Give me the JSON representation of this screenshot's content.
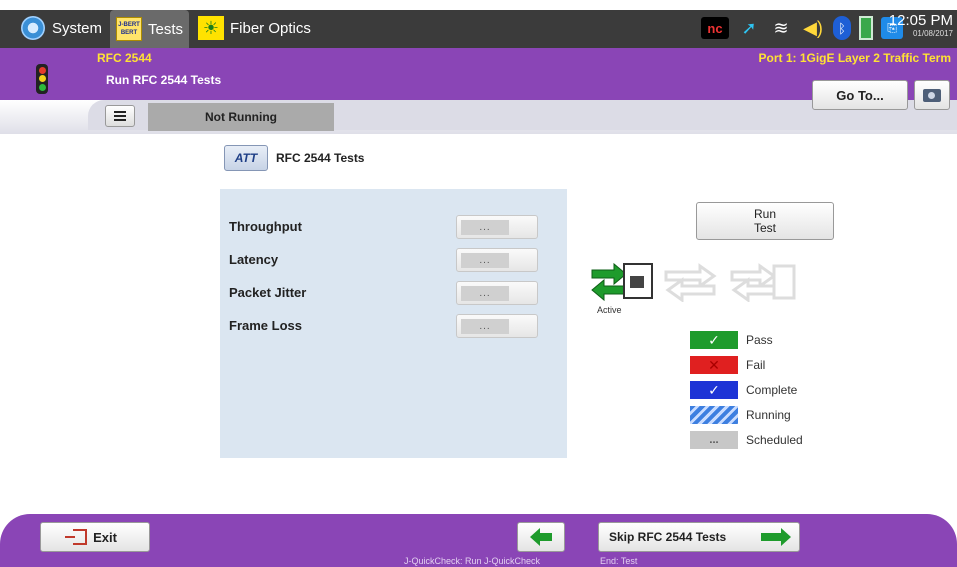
{
  "topbar": {
    "tabs": [
      {
        "label": "System",
        "icon": "gear-icon"
      },
      {
        "label": "Tests",
        "icon": "bert-icon",
        "icon_text": [
          "J-BERT",
          "BERT"
        ]
      },
      {
        "label": "Fiber Optics",
        "icon": "fiber-optics-icon"
      }
    ],
    "status": {
      "nc": "nc",
      "time": "12:05 PM",
      "date": "01/08/2017"
    }
  },
  "header": {
    "mode": "RFC 2544",
    "port": "Port 1: 1GigE Layer 2 Traffic Term",
    "title": "Run RFC 2544 Tests",
    "goto_label": "Go To..."
  },
  "subbar": {
    "state": "Not Running"
  },
  "main": {
    "section_title": "RFC 2544 Tests",
    "section_icon_text": "ATT",
    "tests": [
      {
        "label": "Throughput",
        "status": "..."
      },
      {
        "label": "Latency",
        "status": "..."
      },
      {
        "label": "Packet Jitter",
        "status": "..."
      },
      {
        "label": "Frame Loss",
        "status": "..."
      }
    ],
    "run_test": [
      "Run",
      "Test"
    ],
    "active_label": "Active",
    "legend": [
      {
        "label": "Pass",
        "color": "#1e9b2c",
        "symbol": "✓"
      },
      {
        "label": "Fail",
        "color": "#e02020",
        "symbol": "✕"
      },
      {
        "label": "Complete",
        "color": "#1d34d6",
        "symbol": "✓"
      },
      {
        "label": "Running",
        "color": "#3d7fe0",
        "symbol": ""
      },
      {
        "label": "Scheduled",
        "color": "#c7c7c7",
        "symbol": "..."
      }
    ]
  },
  "bottom": {
    "exit_label": "Exit",
    "skip_label": "Skip RFC 2544 Tests",
    "hint_left": "J-QuickCheck: Run J-QuickCheck",
    "hint_right": "End: Test"
  },
  "colors": {
    "accent": "#8a45b6",
    "header_text": "#ffe234",
    "panel": "#dbe6f1"
  }
}
